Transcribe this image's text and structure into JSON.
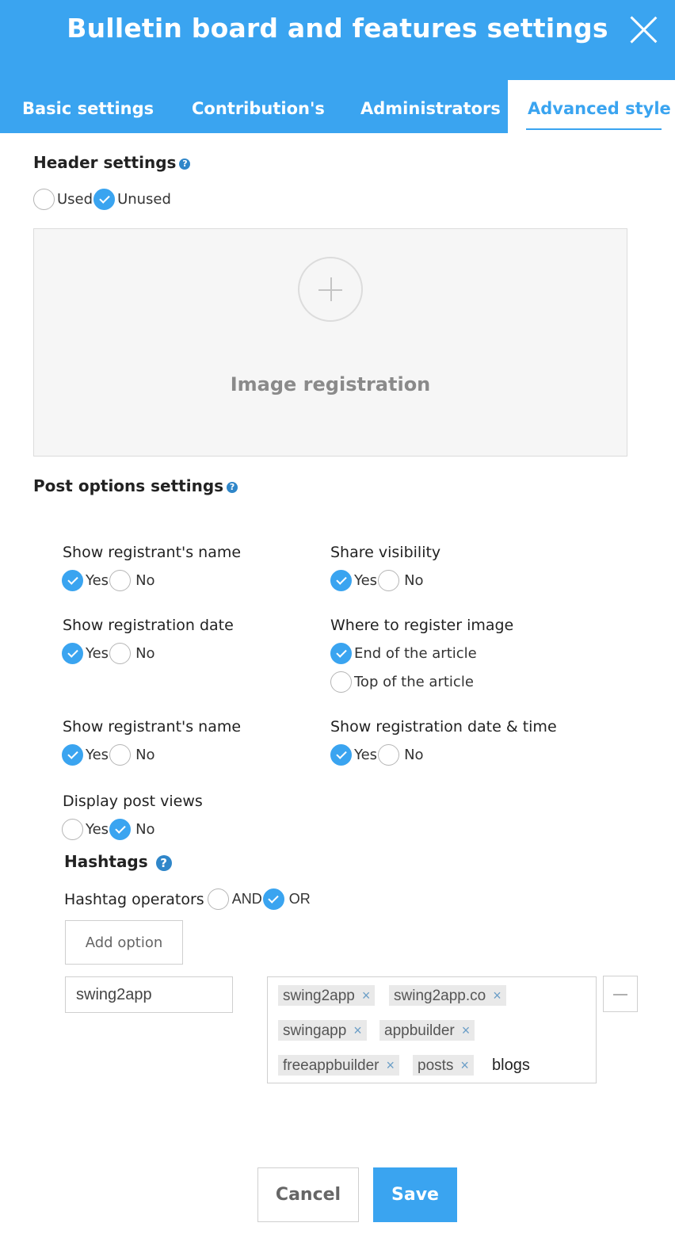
{
  "dialog": {
    "title": "Bulletin board and features settings",
    "accent_color": "#3aa4f0",
    "close_icon": "close-icon"
  },
  "tabs": [
    {
      "label": "Basic settings",
      "active": false
    },
    {
      "label": "Contribution's",
      "active": false
    },
    {
      "label": "Administrators",
      "active": false
    },
    {
      "label": "Advanced style",
      "active": true
    }
  ],
  "header_settings": {
    "title": "Header settings",
    "help": "?",
    "options": [
      {
        "label": "Used",
        "checked": false
      },
      {
        "label": "Unused",
        "checked": true
      }
    ],
    "image_label": "Image registration"
  },
  "post_options": {
    "title": "Post options settings",
    "help": "?",
    "fields": [
      {
        "label": "Show registrant's name",
        "options": [
          {
            "label": "Yes",
            "checked": true
          },
          {
            "label": "No",
            "checked": false
          }
        ]
      },
      {
        "label": "Share visibility",
        "options": [
          {
            "label": "Yes",
            "checked": true
          },
          {
            "label": "No",
            "checked": false
          }
        ]
      },
      {
        "label": "Show registration date",
        "options": [
          {
            "label": "Yes",
            "checked": true
          },
          {
            "label": "No",
            "checked": false
          }
        ]
      },
      {
        "label": "Where to register image",
        "options": [
          {
            "label": "End of the article",
            "checked": true
          },
          {
            "label": "Top of the article",
            "checked": false
          }
        ]
      },
      {
        "label": "Show registrant's name",
        "options": [
          {
            "label": "Yes",
            "checked": true
          },
          {
            "label": "No",
            "checked": false
          }
        ]
      },
      {
        "label": "Show registration date & time",
        "options": [
          {
            "label": "Yes",
            "checked": true
          },
          {
            "label": "No",
            "checked": false
          }
        ]
      },
      {
        "label": "Display post views",
        "options": [
          {
            "label": "Yes",
            "checked": false
          },
          {
            "label": "No",
            "checked": true
          }
        ]
      }
    ]
  },
  "hashtags": {
    "title": "Hashtags",
    "help": "?",
    "operators_label": "Hashtag operators",
    "operators": [
      {
        "label": "AND",
        "checked": false
      },
      {
        "label": "OR",
        "checked": true
      }
    ],
    "add_option_label": "Add option",
    "input_value": "swing2app",
    "tags": [
      "swing2app",
      "swing2app.co",
      "swingapp",
      "appbuilder",
      "freeappbuilder",
      "posts"
    ],
    "tag_remove_glyph": "×",
    "typing_value": "blogs"
  },
  "footer": {
    "cancel_label": "Cancel",
    "save_label": "Save"
  }
}
